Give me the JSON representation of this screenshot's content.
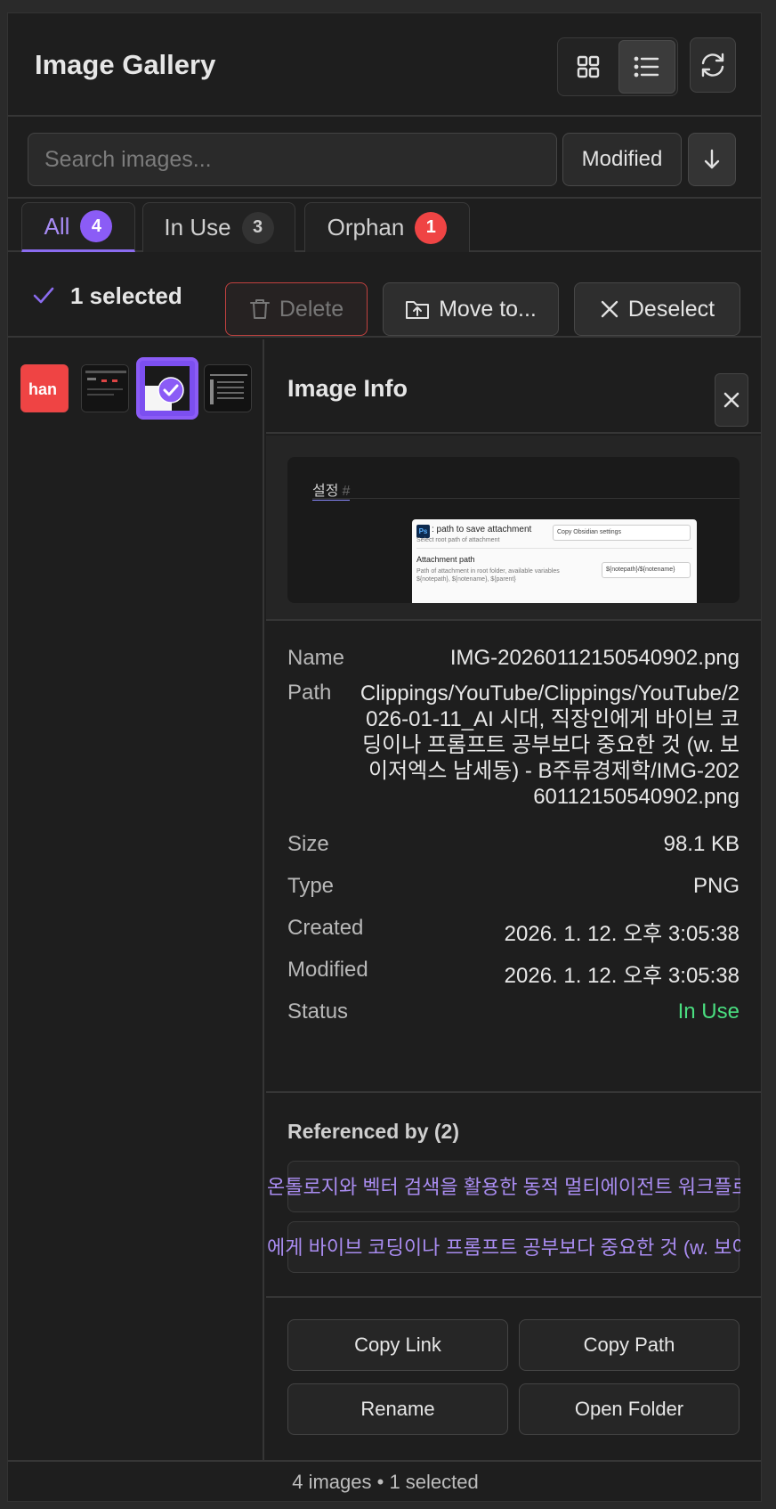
{
  "header": {
    "title": "Image Gallery",
    "view_modes": [
      "grid-icon",
      "list-icon"
    ],
    "active_view": "list",
    "refresh_icon": "refresh-icon"
  },
  "search": {
    "placeholder": "Search images...",
    "value": "",
    "sort_label": "Modified",
    "sort_direction_icon": "arrow-down-icon"
  },
  "tabs": [
    {
      "label": "All",
      "count": "4",
      "active": true
    },
    {
      "label": "In Use",
      "count": "3",
      "active": false
    },
    {
      "label": "Orphan",
      "count": "1",
      "active": false
    }
  ],
  "selection": {
    "count_label": "1 selected",
    "delete_label": "Delete",
    "move_label": "Move to...",
    "deselect_label": "Deselect"
  },
  "thumbnails": {
    "first_label": "han"
  },
  "info": {
    "title": "Image Info",
    "preview": {
      "heading": "설정",
      "hash": "#",
      "ps_icon": "Ps",
      "setting1_title": ": path to save attachment",
      "setting1_sub": "Select root path of attachment",
      "setting1_value": "Copy Obsidian settings",
      "setting2_title": "Attachment path",
      "setting2_sub": "Path of attachment in root folder, available variables ${notepath}, ${notename}, ${parent}",
      "setting2_value": "${notepath}/${notename}"
    },
    "fields": {
      "name_label": "Name",
      "name_value": "IMG-20260112150540902.png",
      "path_label": "Path",
      "path_value": "Clippings/YouTube/Clippings/YouTube/2026-01-11_AI 시대, 직장인에게 바이브 코딩이나 프롬프트 공부보다 중요한 것 (w. 보이저엑스 남세동) - B주류경제학/IMG-20260112150540902.png",
      "size_label": "Size",
      "size_value": "98.1 KB",
      "type_label": "Type",
      "type_value": "PNG",
      "created_label": "Created",
      "created_value": "2026. 1. 12. 오후 3:05:38",
      "modified_label": "Modified",
      "modified_value": "2026. 1. 12. 오후 3:05:38",
      "status_label": "Status",
      "status_value": "In Use",
      "status_color": "#4ade80"
    },
    "references": {
      "title": "Referenced by (2)",
      "items": [
        "온톨로지와 벡터 검색을 활용한 동적 멀티에이전트 워크플로",
        "에게 바이브 코딩이나 프롬프트 공부보다 중요한 것 (w. 보이"
      ]
    },
    "actions": {
      "copy_link": "Copy Link",
      "copy_path": "Copy Path",
      "rename": "Rename",
      "open_folder": "Open Folder"
    }
  },
  "footer": {
    "status": "4 images • 1 selected"
  },
  "colors": {
    "accent": "#8b5cf6",
    "danger": "#ef4444",
    "success": "#4ade80"
  }
}
